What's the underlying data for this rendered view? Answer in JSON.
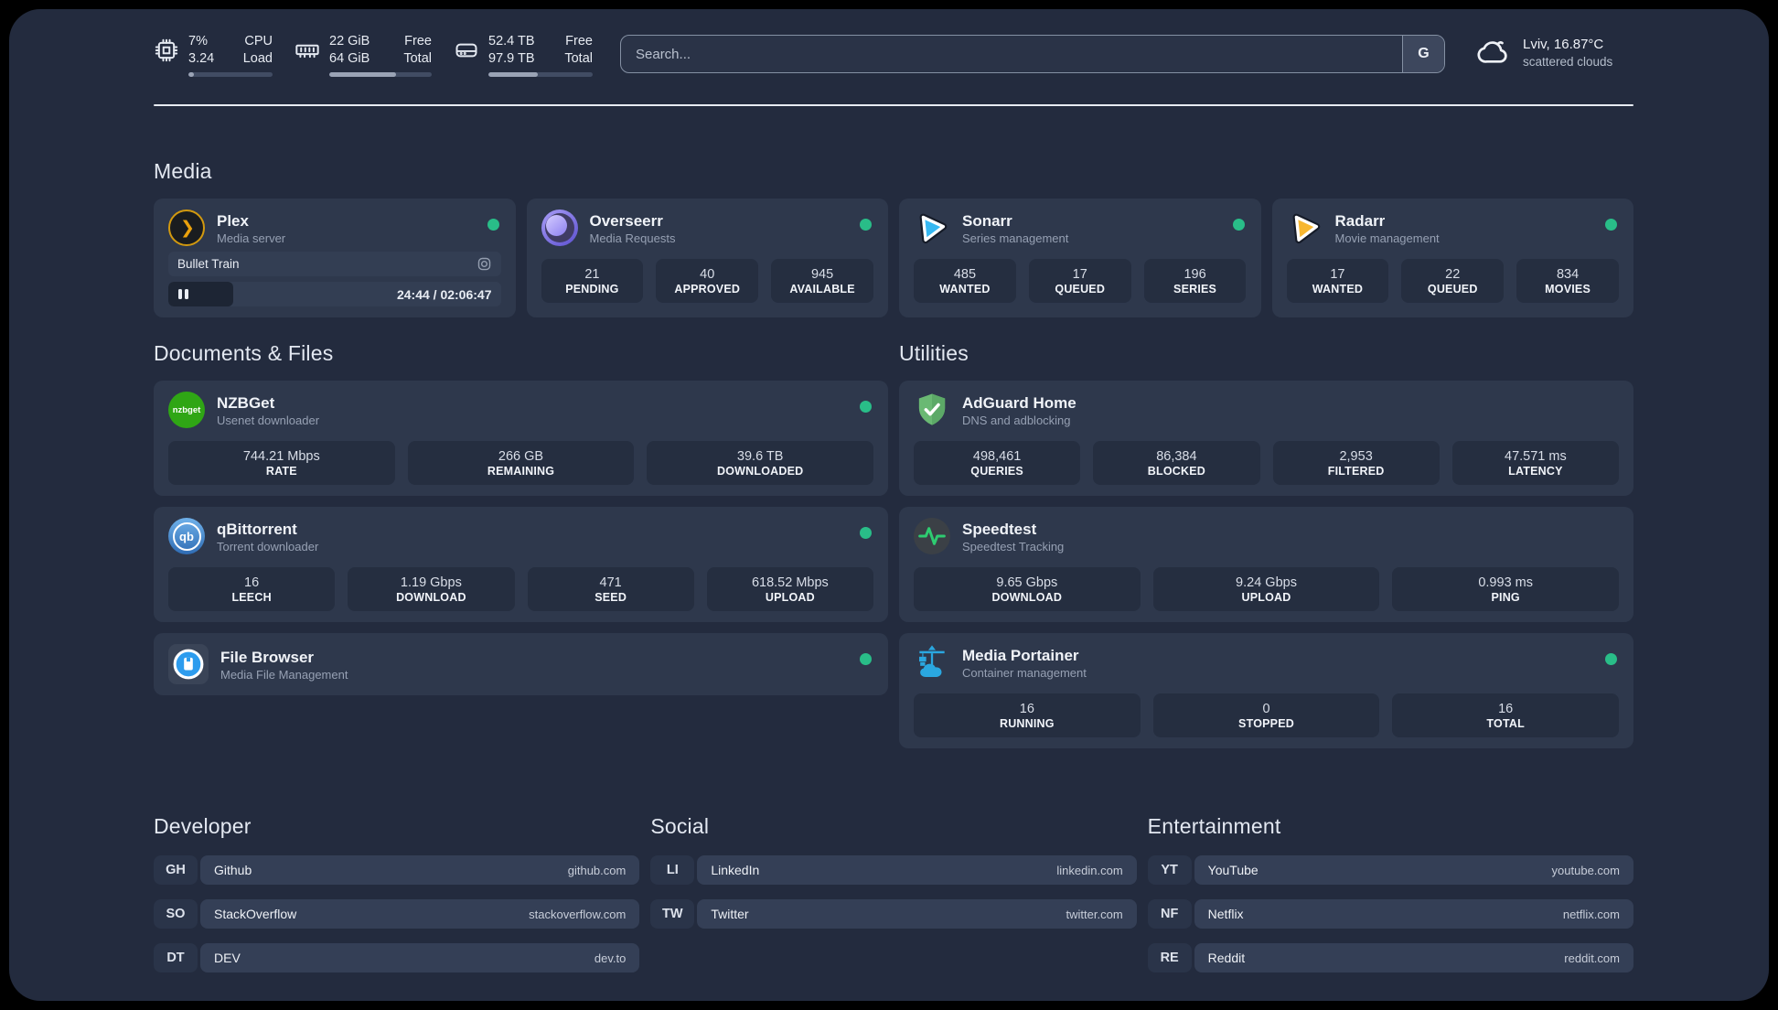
{
  "colors": {
    "accent_green": "#29bd88",
    "background": "#232b3e",
    "card": "#2e384c"
  },
  "topbar": {
    "cpu": {
      "icon": "cpu-icon",
      "value_top": "7%",
      "value_bottom": "3.24",
      "label_top": "CPU",
      "label_bottom": "Load",
      "progress_pct": 7
    },
    "memory": {
      "icon": "ram-icon",
      "value_top": "22 GiB",
      "value_bottom": "64 GiB",
      "label_top": "Free",
      "label_bottom": "Total",
      "progress_pct": 65
    },
    "disk": {
      "icon": "disk-icon",
      "value_top": "52.4 TB",
      "value_bottom": "97.9 TB",
      "label_top": "Free",
      "label_bottom": "Total",
      "progress_pct": 47
    },
    "search": {
      "placeholder": "Search...",
      "engine_button": "G"
    },
    "weather": {
      "location_temp": "Lviv, 16.87°C",
      "condition": "scattered clouds"
    }
  },
  "media": {
    "section_title": "Media",
    "plex": {
      "title": "Plex",
      "subtitle": "Media server",
      "icon_glyph": "❯",
      "now_playing": "Bullet Train",
      "time": "24:44 / 02:06:47",
      "progress_pct": 19.5
    },
    "overseerr": {
      "title": "Overseerr",
      "subtitle": "Media Requests",
      "stats": [
        {
          "value": "21",
          "label": "PENDING"
        },
        {
          "value": "40",
          "label": "APPROVED"
        },
        {
          "value": "945",
          "label": "AVAILABLE"
        }
      ]
    },
    "sonarr": {
      "title": "Sonarr",
      "subtitle": "Series management",
      "stats": [
        {
          "value": "485",
          "label": "WANTED"
        },
        {
          "value": "17",
          "label": "QUEUED"
        },
        {
          "value": "196",
          "label": "SERIES"
        }
      ]
    },
    "radarr": {
      "title": "Radarr",
      "subtitle": "Movie management",
      "stats": [
        {
          "value": "17",
          "label": "WANTED"
        },
        {
          "value": "22",
          "label": "QUEUED"
        },
        {
          "value": "834",
          "label": "MOVIES"
        }
      ]
    }
  },
  "documents": {
    "section_title": "Documents & Files",
    "nzbget": {
      "title": "NZBGet",
      "subtitle": "Usenet downloader",
      "icon_text": "nzbget",
      "stats": [
        {
          "value": "744.21 Mbps",
          "label": "RATE"
        },
        {
          "value": "266 GB",
          "label": "REMAINING"
        },
        {
          "value": "39.6 TB",
          "label": "DOWNLOADED"
        }
      ]
    },
    "qbittorrent": {
      "title": "qBittorrent",
      "subtitle": "Torrent downloader",
      "icon_text": "qb",
      "stats": [
        {
          "value": "16",
          "label": "LEECH"
        },
        {
          "value": "1.19 Gbps",
          "label": "DOWNLOAD"
        },
        {
          "value": "471",
          "label": "SEED"
        },
        {
          "value": "618.52 Mbps",
          "label": "UPLOAD"
        }
      ]
    },
    "filebrowser": {
      "title": "File Browser",
      "subtitle": "Media File Management"
    }
  },
  "utilities": {
    "section_title": "Utilities",
    "adguard": {
      "title": "AdGuard Home",
      "subtitle": "DNS and adblocking",
      "stats": [
        {
          "value": "498,461",
          "label": "QUERIES"
        },
        {
          "value": "86,384",
          "label": "BLOCKED"
        },
        {
          "value": "2,953",
          "label": "FILTERED"
        },
        {
          "value": "47.571 ms",
          "label": "LATENCY"
        }
      ]
    },
    "speedtest": {
      "title": "Speedtest",
      "subtitle": "Speedtest Tracking",
      "stats": [
        {
          "value": "9.65 Gbps",
          "label": "DOWNLOAD"
        },
        {
          "value": "9.24 Gbps",
          "label": "UPLOAD"
        },
        {
          "value": "0.993 ms",
          "label": "PING"
        }
      ]
    },
    "portainer": {
      "title": "Media Portainer",
      "subtitle": "Container management",
      "stats": [
        {
          "value": "16",
          "label": "RUNNING"
        },
        {
          "value": "0",
          "label": "STOPPED"
        },
        {
          "value": "16",
          "label": "TOTAL"
        }
      ]
    }
  },
  "bookmarks": {
    "developer": {
      "section_title": "Developer",
      "links": [
        {
          "abbr": "GH",
          "name": "Github",
          "domain": "github.com"
        },
        {
          "abbr": "SO",
          "name": "StackOverflow",
          "domain": "stackoverflow.com"
        },
        {
          "abbr": "DT",
          "name": "DEV",
          "domain": "dev.to"
        }
      ]
    },
    "social": {
      "section_title": "Social",
      "links": [
        {
          "abbr": "LI",
          "name": "LinkedIn",
          "domain": "linkedin.com"
        },
        {
          "abbr": "TW",
          "name": "Twitter",
          "domain": "twitter.com"
        }
      ]
    },
    "entertainment": {
      "section_title": "Entertainment",
      "links": [
        {
          "abbr": "YT",
          "name": "YouTube",
          "domain": "youtube.com"
        },
        {
          "abbr": "NF",
          "name": "Netflix",
          "domain": "netflix.com"
        },
        {
          "abbr": "RE",
          "name": "Reddit",
          "domain": "reddit.com"
        }
      ]
    }
  }
}
